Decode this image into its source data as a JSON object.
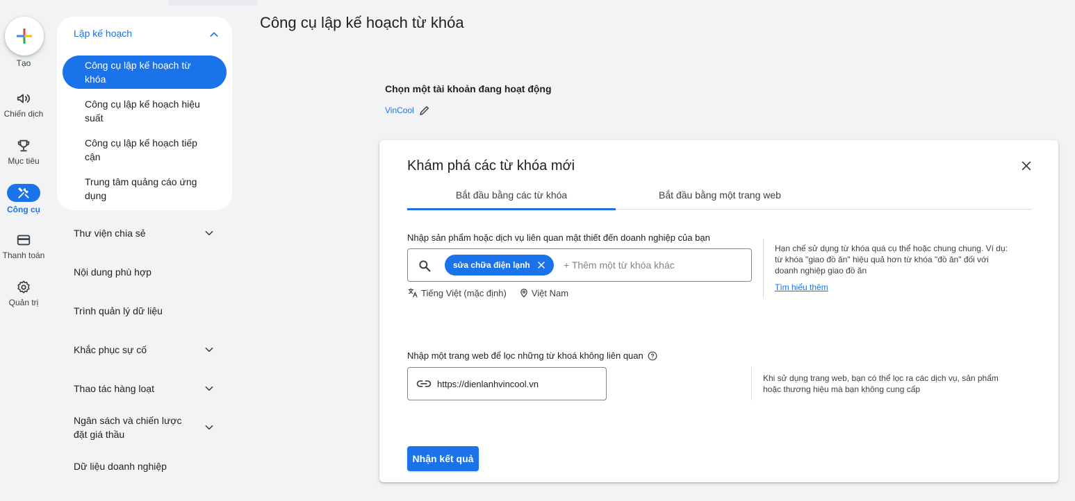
{
  "rail": {
    "create_label": "Tạo",
    "items": [
      {
        "label": "Chiến dịch",
        "icon": "megaphone-icon"
      },
      {
        "label": "Mục tiêu",
        "icon": "trophy-icon"
      },
      {
        "label": "Công cụ",
        "icon": "tools-icon",
        "active": true
      },
      {
        "label": "Thanh toán",
        "icon": "credit-card-icon"
      },
      {
        "label": "Quản trị",
        "icon": "gear-icon"
      }
    ]
  },
  "nav": {
    "section_title": "Lập kế hoạch",
    "sub_items": [
      {
        "label": "Công cụ lập kế hoạch từ khóa",
        "active": true
      },
      {
        "label": "Công cụ lập kế hoạch hiệu suất"
      },
      {
        "label": "Công cụ lập kế hoạch tiếp cận"
      },
      {
        "label": "Trung tâm quảng cáo ứng dụng"
      }
    ],
    "items": [
      {
        "label": "Thư viện chia sẻ",
        "expandable": true
      },
      {
        "label": "Nội dung phù hợp",
        "expandable": false
      },
      {
        "label": "Trình quản lý dữ liệu",
        "expandable": false
      },
      {
        "label": "Khắc phục sự cố",
        "expandable": true
      },
      {
        "label": "Thao tác hàng loạt",
        "expandable": true
      },
      {
        "label": "Ngân sách và chiến lược đặt giá thầu",
        "expandable": true
      },
      {
        "label": "Dữ liệu doanh nghiệp",
        "expandable": false
      }
    ]
  },
  "main": {
    "page_title": "Công cụ lập kế hoạch từ khóa",
    "account_label": "Chọn một tài khoản đang hoạt động",
    "account_name": "VinCool"
  },
  "card": {
    "title": "Khám phá các từ khóa mới",
    "tabs": [
      {
        "label": "Bắt đầu bằng các từ khóa",
        "active": true
      },
      {
        "label": "Bắt đầu bằng một trang web",
        "active": false
      }
    ],
    "keywords": {
      "label": "Nhập sản phẩm hoặc dịch vụ liên quan mật thiết đến doanh nghiệp của bạn",
      "chip": "sửa chữa điện lạnh",
      "placeholder": "+ Thêm một từ khóa khác",
      "language": "Tiếng Việt (mặc định)",
      "location": "Việt Nam",
      "helper_text": "Hạn chế sử dụng từ khóa quá cụ thể hoặc chung chung. Ví dụ: từ khóa \"giao đồ ăn\" hiệu quả hơn từ khóa \"đồ ăn\" đối với doanh nghiệp giao đồ ăn",
      "helper_link": "Tìm hiểu thêm"
    },
    "website": {
      "label": "Nhập một trang web để lọc những từ khoá không liên quan",
      "value": "https://dienlanhvincool.vn",
      "helper_text": "Khi sử dụng trang web, bạn có thể lọc ra các dịch vụ, sản phẩm hoặc thương hiệu mà bạn không cung cấp"
    },
    "submit_label": "Nhận kết quả"
  },
  "colors": {
    "accent": "#1a73e8",
    "background": "#f1f3f4"
  }
}
